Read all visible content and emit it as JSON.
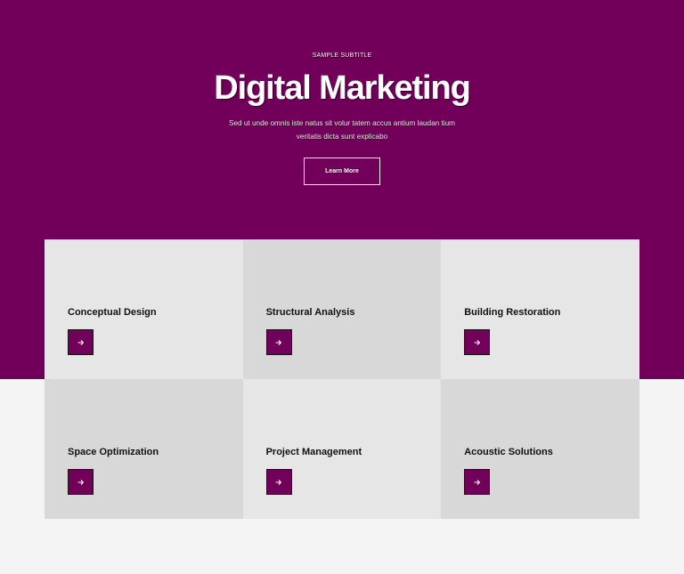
{
  "colors": {
    "brand_purple": "#72005a",
    "hero_text": "#ffffff",
    "card_light": "#e6e6e6",
    "card_dark": "#d8d8d8",
    "page_background": "#f4f4f4"
  },
  "hero": {
    "subtitle": "SAMPLE SUBTITLE",
    "title": "Digital Marketing",
    "description": "Sed ut unde omnis iste natus sit volur tatem accus antium laudan tium veritatis dicta sunt explicabo",
    "button_label": "Learn More"
  },
  "services": {
    "items": [
      {
        "title": "Conceptual Design",
        "arrow_icon": "arrow-right-icon"
      },
      {
        "title": "Structural Analysis",
        "arrow_icon": "arrow-right-icon"
      },
      {
        "title": "Building Restoration",
        "arrow_icon": "arrow-right-icon"
      },
      {
        "title": "Space Optimization",
        "arrow_icon": "arrow-right-icon"
      },
      {
        "title": "Project Management",
        "arrow_icon": "arrow-right-icon"
      },
      {
        "title": "Acoustic Solutions",
        "arrow_icon": "arrow-right-icon"
      }
    ]
  }
}
